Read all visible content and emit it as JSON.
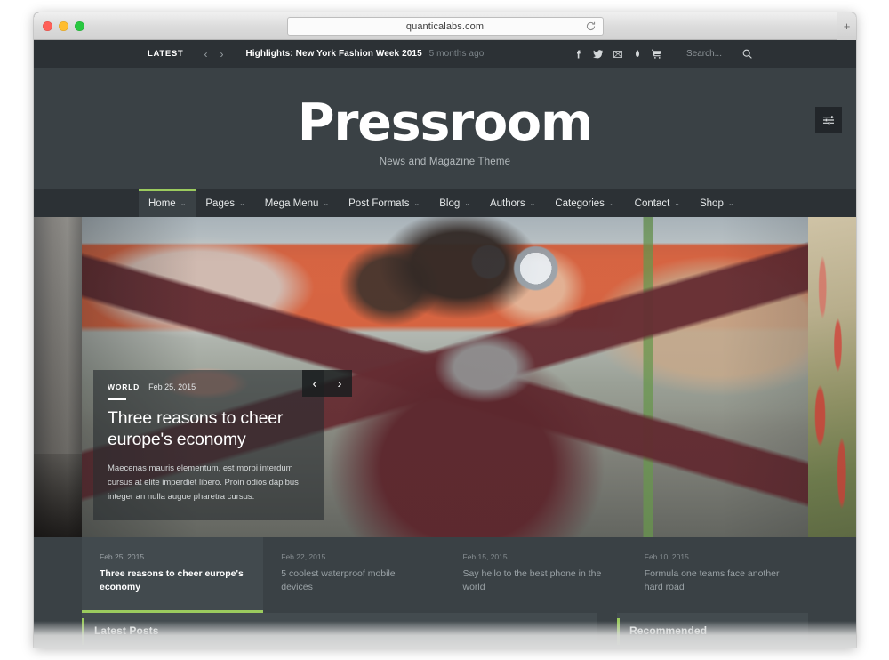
{
  "browser": {
    "url": "quanticalabs.com",
    "reload_icon": "reload-icon",
    "new_tab_label": "+",
    "traffic_lights": [
      "close",
      "minimize",
      "maximize"
    ]
  },
  "topbar": {
    "latest_label": "LATEST",
    "prev_arrow": "‹",
    "next_arrow": "›",
    "ticker_headline": "Highlights: New York Fashion Week 2015",
    "ticker_time": "5 months ago",
    "social_icons": [
      "facebook-icon",
      "twitter-icon",
      "envelope-icon",
      "dribbble-icon",
      "cart-icon"
    ],
    "search_placeholder": "Search...",
    "search_icon": "search-icon"
  },
  "masthead": {
    "site_title": "Pressroom",
    "tagline": "News and Magazine Theme",
    "widget_toggle_icon": "sliders-icon"
  },
  "nav": {
    "items": [
      {
        "label": "Home",
        "caret": "⌄",
        "active": true
      },
      {
        "label": "Pages",
        "caret": "⌄",
        "active": false
      },
      {
        "label": "Mega Menu",
        "caret": "⌄",
        "active": false
      },
      {
        "label": "Post Formats",
        "caret": "⌄",
        "active": false
      },
      {
        "label": "Blog",
        "caret": "⌄",
        "active": false
      },
      {
        "label": "Authors",
        "caret": "⌄",
        "active": false
      },
      {
        "label": "Categories",
        "caret": "⌄",
        "active": false
      },
      {
        "label": "Contact",
        "caret": "⌄",
        "active": false
      },
      {
        "label": "Shop",
        "caret": "⌄",
        "active": false
      }
    ]
  },
  "hero": {
    "category": "WORLD",
    "date": "Feb 25, 2015",
    "title": "Three reasons to cheer europe's economy",
    "excerpt": "Maecenas mauris elementum, est morbi interdum cursus at elite imperdiet libero. Proin odios dapibus integer an nulla augue pharetra cursus.",
    "prev_arrow": "‹",
    "next_arrow": "›"
  },
  "thumbnails": [
    {
      "date": "Feb 25, 2015",
      "title": "Three reasons to cheer europe's economy",
      "active": true
    },
    {
      "date": "Feb 22, 2015",
      "title": "5 coolest waterproof mobile devices",
      "active": false
    },
    {
      "date": "Feb 15, 2015",
      "title": "Say hello to the best phone in the world",
      "active": false
    },
    {
      "date": "Feb 10, 2015",
      "title": "Formula one teams face another hard road",
      "active": false
    }
  ],
  "below_fold": {
    "latest_heading": "Latest Posts",
    "recommended_heading": "Recommended"
  },
  "colors": {
    "accent_green": "#9bcb5e",
    "page_bg": "#3a4145",
    "bar_bg": "#2c3135",
    "panel_bg": "#434b4f"
  }
}
